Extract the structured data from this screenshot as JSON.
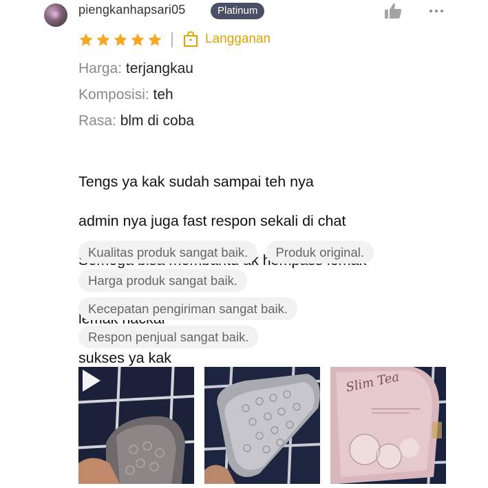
{
  "review": {
    "username": "piengkanhapsari05",
    "badge": "Platinum",
    "rating": 5,
    "rating_max": 5,
    "tag_label": "Langganan",
    "attributes": [
      {
        "label": "Harga:",
        "value": "terjangkau"
      },
      {
        "label": "Komposisi:",
        "value": "teh"
      },
      {
        "label": "Rasa:",
        "value": "blm di coba"
      }
    ],
    "body_line1": "Tengs ya kak sudah sampai teh nya",
    "body_line2": "admin nya juga fast respon sekali di chat",
    "body_line3": "Semoga bisa membantu ak hempass lemak",
    "body_line4a": "lemak nackal",
    "body_line4b": "sukses ya kak",
    "emoji_name": "face-with-tears-of-joy",
    "chips": [
      "Kualitas produk sangat baik.",
      "Produk original.",
      "Harga produk sangat baik.",
      "Kecepatan pengiriman sangat baik.",
      "Respon penjual sangat baik."
    ],
    "photos": [
      {
        "name": "photo-video-package",
        "has_play": true
      },
      {
        "name": "photo-bubble-wrap"
      },
      {
        "name": "photo-slim-tea-box",
        "caption": "Slim Tea"
      }
    ]
  },
  "colors": {
    "star": "#f6a723",
    "subscription": "#e0a400",
    "badge_bg": "#4b4f66",
    "chip_bg": "#f2f2f2",
    "label_gray": "#8a8a8a"
  },
  "icons": {
    "like": "thumbs-up-icon",
    "more": "more-dots-icon",
    "bag": "shopping-bag-icon",
    "play": "play-icon"
  }
}
